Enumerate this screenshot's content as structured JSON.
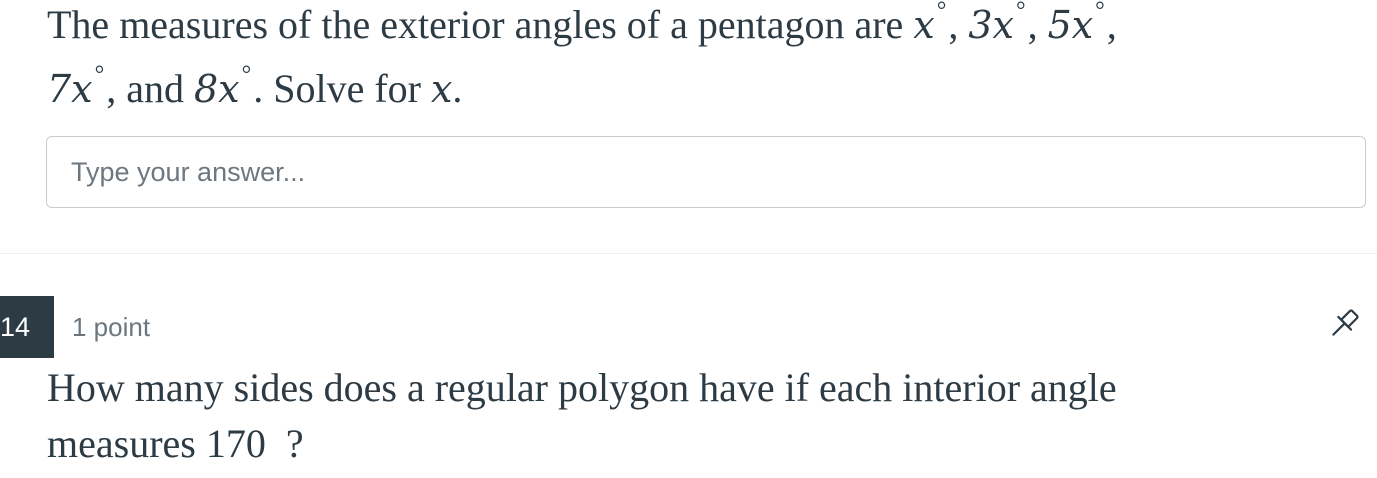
{
  "question_13": {
    "line1_prefix": "The measures of the exterior angles of a pentagon are ",
    "line1_vars": [
      "x",
      "3x",
      "5x"
    ],
    "line2_var1": "7x",
    "line2_mid": ", and ",
    "line2_var2": "8x",
    "line2_suffix": ". Solve for ",
    "line2_solve_var": "x",
    "line2_end": ".",
    "degree_symbol": "°",
    "comma": ",",
    "answer": {
      "value": "",
      "placeholder": "Type your answer..."
    }
  },
  "question_14": {
    "number": "14",
    "points": "1 point",
    "line1": "How many sides does a regular polygon have if each interior angle",
    "line2": "measures 170  ?",
    "pin_icon": "pin-icon"
  }
}
